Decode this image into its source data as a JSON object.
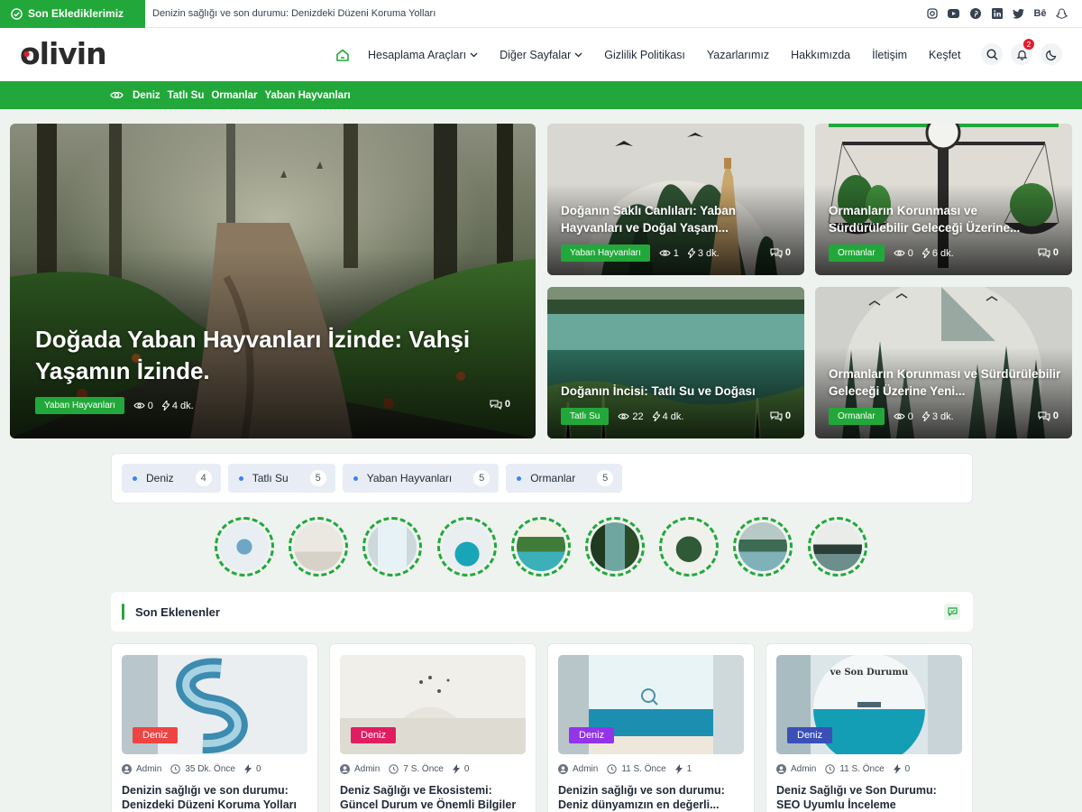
{
  "topbar": {
    "badge": "Son Eklediklerimiz",
    "ticker": "Denizin sağlığı ve son durumu: Denizdeki Düzeni Koruma Yolları",
    "socials": [
      "instagram-icon",
      "youtube-icon",
      "pinterest-icon",
      "linkedin-icon",
      "twitter-icon",
      "behance-icon",
      "snapchat-icon"
    ],
    "behance_text": "Bē"
  },
  "header": {
    "logo_text": "olivin",
    "nav": [
      {
        "label": "Hesaplama Araçları",
        "dropdown": true
      },
      {
        "label": "Diğer Sayfalar",
        "dropdown": true
      },
      {
        "label": "Gizlilik Politikası",
        "dropdown": false
      },
      {
        "label": "Yazarlarımız",
        "dropdown": false
      },
      {
        "label": "Hakkımızda",
        "dropdown": false
      },
      {
        "label": "İletişim",
        "dropdown": false
      },
      {
        "label": "Keşfet",
        "dropdown": false
      }
    ],
    "notification_count": "2"
  },
  "catbar": [
    "Deniz",
    "Tatlı Su",
    "Ormanlar",
    "Yaban Hayvanları"
  ],
  "hero": {
    "main": {
      "title": "Doğada Yaban Hayvanları İzinde: Vahşi Yaşamın İzinde.",
      "category": "Yaban Hayvanları",
      "views": "0",
      "read": "4 dk.",
      "comments": "0"
    },
    "side": [
      {
        "title": "Doğanın Saklı Canlıları: Yaban Hayvanları ve Doğal Yaşam...",
        "category": "Yaban Hayvanları",
        "views": "1",
        "read": "3 dk.",
        "comments": "0"
      },
      {
        "title": "Ormanların Korunması ve Sürdürülebilir Geleceği Üzerine...",
        "category": "Ormanlar",
        "views": "0",
        "read": "6 dk.",
        "comments": "0"
      },
      {
        "title": "Doğanın İncisi: Tatlı Su ve Doğası",
        "category": "Tatlı Su",
        "views": "22",
        "read": "4 dk.",
        "comments": "0"
      },
      {
        "title": "Ormanların Korunması ve Sürdürülebilir Geleceği Üzerine Yeni...",
        "category": "Ormanlar",
        "views": "0",
        "read": "3 dk.",
        "comments": "0"
      }
    ]
  },
  "tags": [
    {
      "label": "Deniz",
      "count": "4"
    },
    {
      "label": "Tatlı Su",
      "count": "5"
    },
    {
      "label": "Yaban Hayvanları",
      "count": "5"
    },
    {
      "label": "Ormanlar",
      "count": "5"
    }
  ],
  "section": {
    "title": "Son Eklenenler"
  },
  "posts": [
    {
      "category": "Deniz",
      "cat_color": "#ef4444",
      "author": "Admin",
      "time": "35 Dk. Önce",
      "count": "0",
      "title": "Denizin sağlığı ve son durumu: Denizdeki Düzeni Koruma Yolları"
    },
    {
      "category": "Deniz",
      "cat_color": "#e11d62",
      "author": "Admin",
      "time": "7 S. Önce",
      "count": "0",
      "title": "Deniz Sağlığı ve Ekosistemi: Güncel Durum ve Önemli Bilgiler"
    },
    {
      "category": "Deniz",
      "cat_color": "#9333ea",
      "author": "Admin",
      "time": "11 S. Önce",
      "count": "1",
      "title": "Denizin sağlığı ve son durumu: Deniz dünyamızın en değerli..."
    },
    {
      "category": "Deniz",
      "cat_color": "#3b4fb8",
      "author": "Admin",
      "time": "11 S. Önce",
      "count": "0",
      "title": "Deniz Sağlığı ve Son Durumu: SEO Uyumlu İnceleme"
    }
  ],
  "thumb4_text": "ve Son Durumu",
  "colors": {
    "accent": "#22a83a",
    "brand_dot": "#e11d2e"
  }
}
